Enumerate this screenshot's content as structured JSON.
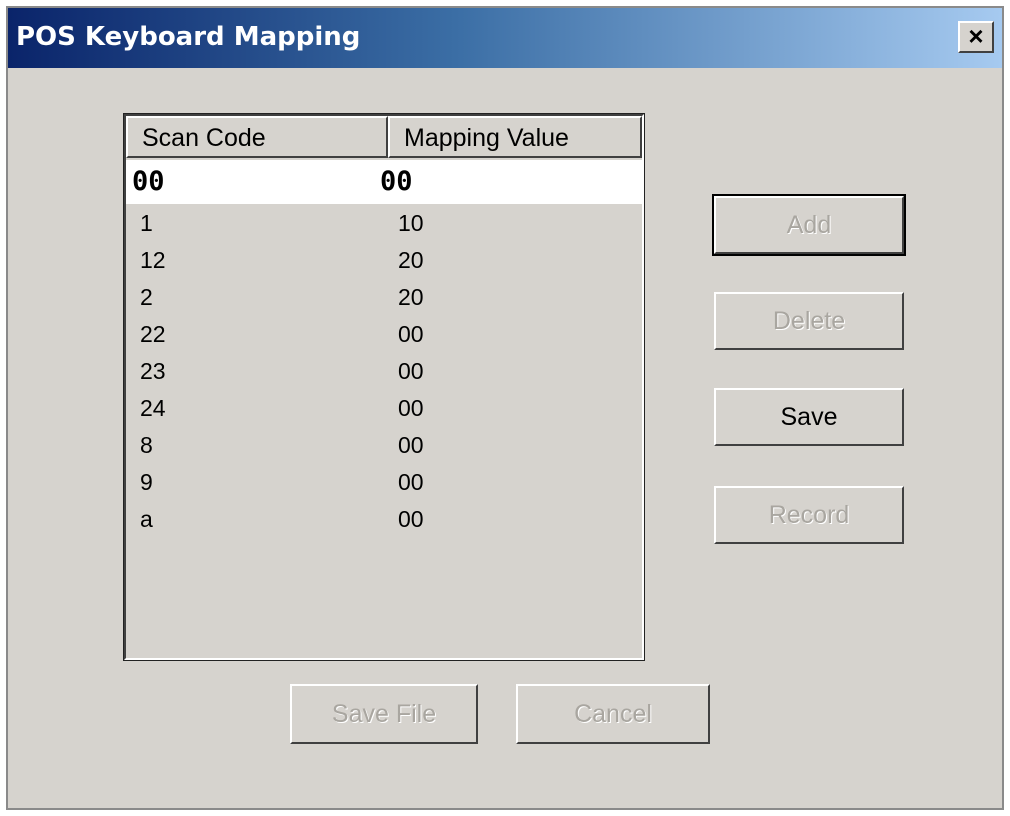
{
  "window": {
    "title": "POS Keyboard Mapping",
    "close_label": "×"
  },
  "list": {
    "columns": [
      "Scan Code",
      "Mapping Value"
    ],
    "rows": [
      {
        "scan_code": "00",
        "mapping_value": "00",
        "selected": true
      },
      {
        "scan_code": "1",
        "mapping_value": "10"
      },
      {
        "scan_code": "12",
        "mapping_value": "20"
      },
      {
        "scan_code": "2",
        "mapping_value": "20"
      },
      {
        "scan_code": "22",
        "mapping_value": "00"
      },
      {
        "scan_code": "23",
        "mapping_value": "00"
      },
      {
        "scan_code": "24",
        "mapping_value": "00"
      },
      {
        "scan_code": "8",
        "mapping_value": "00"
      },
      {
        "scan_code": "9",
        "mapping_value": "00"
      },
      {
        "scan_code": "a",
        "mapping_value": "00"
      }
    ]
  },
  "buttons": {
    "add": "Add",
    "delete": "Delete",
    "save": "Save",
    "record": "Record",
    "save_file": "Save File",
    "cancel": "Cancel"
  }
}
